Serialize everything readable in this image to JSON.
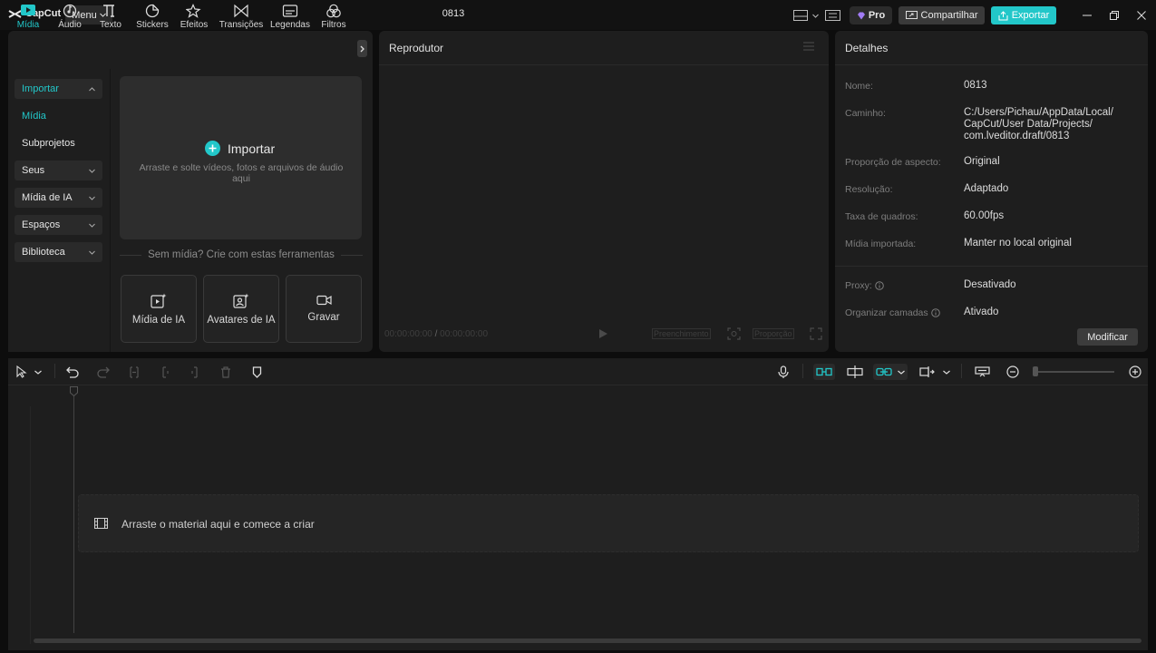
{
  "app": {
    "name": "CapCut",
    "menu_label": "Menu",
    "project_title": "0813"
  },
  "titlebar": {
    "pro_label": "Pro",
    "share_label": "Compartilhar",
    "export_label": "Exportar"
  },
  "colors": {
    "accent": "#22c7c9",
    "panel": "#1e1e1e",
    "background": "#0d0d0d"
  },
  "media_tabs": [
    {
      "label": "Mídia",
      "icon": "media-icon",
      "active": true
    },
    {
      "label": "Áudio",
      "icon": "audio-icon"
    },
    {
      "label": "Texto",
      "icon": "text-icon"
    },
    {
      "label": "Stickers",
      "icon": "sticker-icon"
    },
    {
      "label": "Efeitos",
      "icon": "effects-icon"
    },
    {
      "label": "Transições",
      "icon": "transitions-icon"
    },
    {
      "label": "Legendas",
      "icon": "captions-icon"
    },
    {
      "label": "Filtros",
      "icon": "filters-icon"
    }
  ],
  "sidebar": {
    "items": [
      {
        "label": "Importar"
      },
      {
        "label": "Mídia"
      },
      {
        "label": "Subprojetos"
      },
      {
        "label": "Seus"
      },
      {
        "label": "Mídia de IA"
      },
      {
        "label": "Espaços"
      },
      {
        "label": "Biblioteca"
      }
    ]
  },
  "import": {
    "title": "Importar",
    "subtitle": "Arraste e solte vídeos, fotos e arquivos de áudio aqui",
    "no_media_text": "Sem mídia? Crie com estas ferramentas"
  },
  "tools": [
    {
      "label": "Mídia de IA",
      "icon": "ai-media-icon"
    },
    {
      "label": "Avatares de IA",
      "icon": "ai-avatar-icon"
    },
    {
      "label": "Gravar",
      "icon": "record-icon"
    }
  ],
  "player": {
    "title": "Reprodutor",
    "current_time": "00:00:00:00",
    "total_time": "00:00:00:00",
    "fill_label": "Preenchimento",
    "ratio_label": "Proporção"
  },
  "details": {
    "title": "Detalhes",
    "rows": [
      {
        "label": "Nome:",
        "value": "0813"
      },
      {
        "label": "Caminho:",
        "value": "C:/Users/Pichau/AppData/Local/ CapCut/User Data/Projects/ com.lveditor.draft/0813"
      },
      {
        "label": "Proporção de aspecto:",
        "value": "Original"
      },
      {
        "label": "Resolução:",
        "value": "Adaptado"
      },
      {
        "label": "Taxa de quadros:",
        "value": "60.00fps"
      },
      {
        "label": "Mídia importada:",
        "value": "Manter no local original"
      },
      {
        "label": "Proxy:",
        "value": "Desativado"
      },
      {
        "label": "Organizar camadas",
        "value": "Ativado"
      }
    ],
    "modify_label": "Modificar"
  },
  "timeline": {
    "drop_text": "Arraste o material aqui e comece a criar"
  }
}
